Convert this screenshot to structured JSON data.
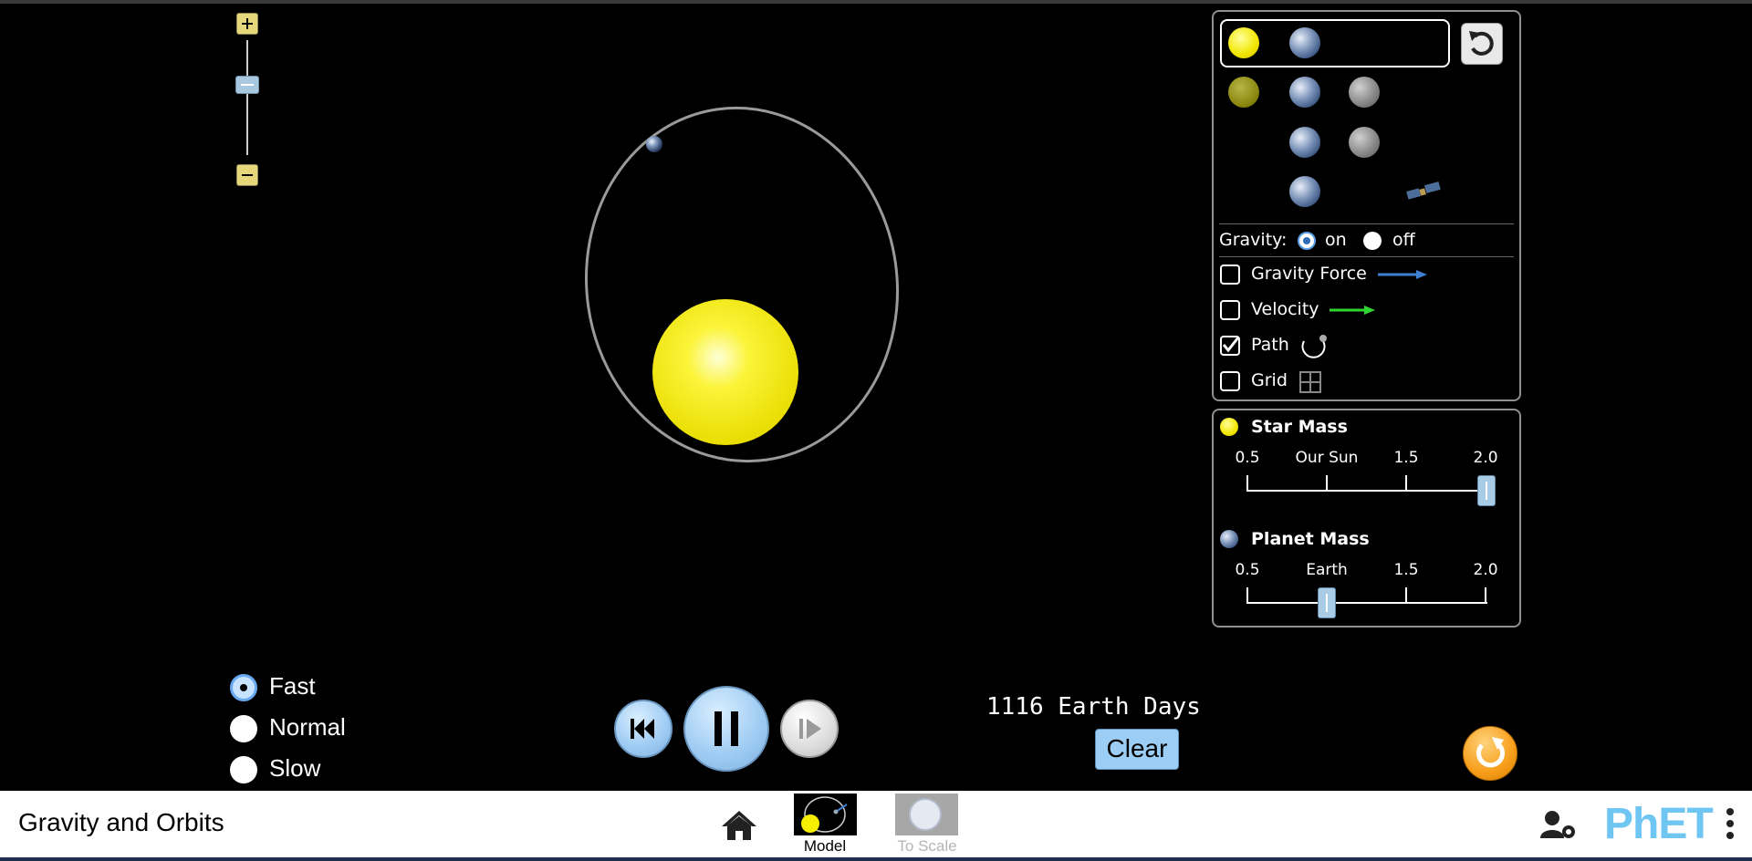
{
  "app": {
    "title": "Gravity and Orbits"
  },
  "gravity": {
    "label": "Gravity:",
    "on_label": "on",
    "off_label": "off",
    "selected": "on"
  },
  "options": {
    "gravity_force": {
      "label": "Gravity Force",
      "checked": false,
      "arrow_color": "#3f7fd0"
    },
    "velocity": {
      "label": "Velocity",
      "checked": false,
      "arrow_color": "#2fd62f"
    },
    "path": {
      "label": "Path",
      "checked": true
    },
    "grid": {
      "label": "Grid",
      "checked": false
    }
  },
  "star_mass": {
    "title": "Star Mass",
    "ticks": [
      "0.5",
      "Our Sun",
      "1.5",
      "2.0"
    ],
    "value": 2.0
  },
  "planet_mass": {
    "title": "Planet Mass",
    "ticks": [
      "0.5",
      "Earth",
      "1.5",
      "2.0"
    ],
    "value": 1.0
  },
  "speed": {
    "options": [
      "Fast",
      "Normal",
      "Slow"
    ],
    "selected": "Fast"
  },
  "time": {
    "elapsed": "1116 Earth Days",
    "clear_label": "Clear"
  },
  "nav": {
    "screens": [
      {
        "label": "Model",
        "selected": true
      },
      {
        "label": "To Scale",
        "selected": false
      }
    ],
    "brand": "PhET"
  },
  "colors": {
    "star": "#f5ee00",
    "orbit_path": "#9a9a9a",
    "panel_border": "#8f8f8f",
    "button_blue": "#9ccaf2",
    "reset_orange": "#f79e1b",
    "brand": "#6fc6f3"
  },
  "icons": [
    "zoom-in-icon",
    "zoom-out-icon",
    "reset-icon",
    "step-back-icon",
    "pause-icon",
    "step-forward-icon",
    "reset-all-icon",
    "home-icon",
    "preferences-icon",
    "menu-icon",
    "satellite-icon",
    "grid-icon",
    "path-icon"
  ]
}
